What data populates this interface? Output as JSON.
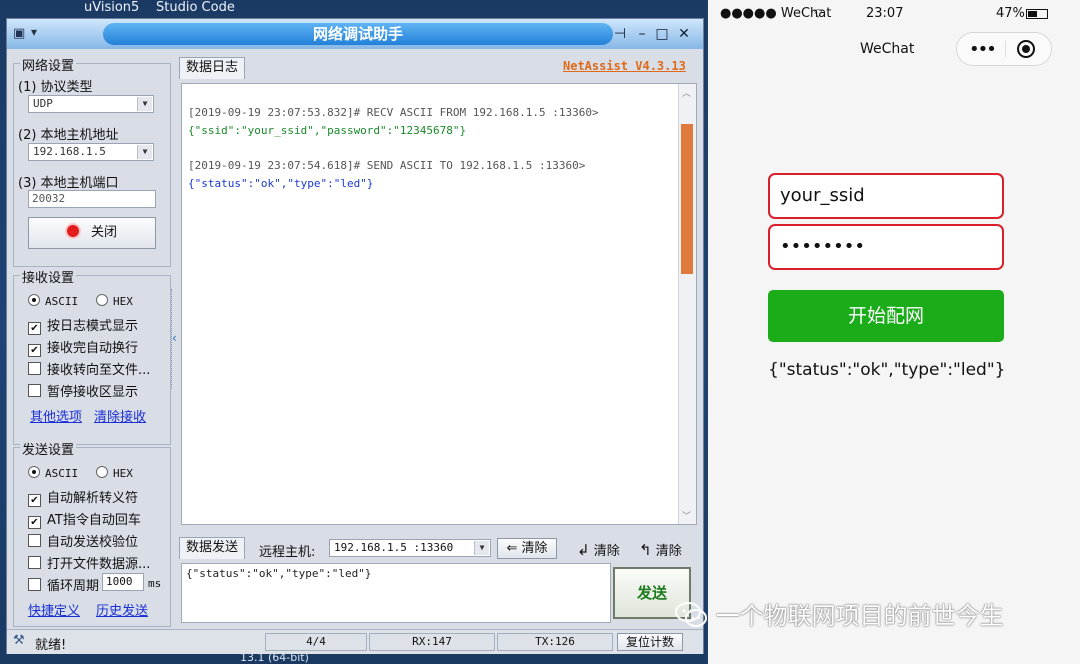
{
  "desktop": {
    "taskbar_top": [
      "uVision5",
      "Studio Code"
    ],
    "taskbar_bottom": "13.1 (64-bit)"
  },
  "netassist": {
    "title": "网络调试助手",
    "version": "NetAssist V4.3.13",
    "net_settings": {
      "title": "网络设置",
      "protocol_label": "(1) 协议类型",
      "protocol_value": "UDP",
      "host_label": "(2) 本地主机地址",
      "host_value": "192.168.1.5",
      "port_label": "(3) 本地主机端口",
      "port_value": "20032",
      "close_button": "关闭"
    },
    "recv_settings": {
      "title": "接收设置",
      "ascii": "ASCII",
      "hex": "HEX",
      "options": [
        {
          "label": "按日志模式显示",
          "checked": true
        },
        {
          "label": "接收完自动换行",
          "checked": true
        },
        {
          "label": "接收转向至文件...",
          "checked": false
        },
        {
          "label": "暂停接收区显示",
          "checked": false
        }
      ],
      "more_link": "其他选项",
      "clear_link": "清除接收"
    },
    "send_settings": {
      "title": "发送设置",
      "ascii": "ASCII",
      "hex": "HEX",
      "options": [
        {
          "label": "自动解析转义符",
          "checked": true
        },
        {
          "label": "AT指令自动回车",
          "checked": true
        },
        {
          "label": "自动发送校验位",
          "checked": false
        },
        {
          "label": "打开文件数据源...",
          "checked": false
        }
      ],
      "loop_label": "循环周期",
      "loop_value": "1000",
      "loop_unit": "ms",
      "shortcut_link": "快捷定义",
      "history_link": "历史发送"
    },
    "log_tab": "数据日志",
    "log": [
      {
        "header": "[2019-09-19 23:07:53.832]# RECV ASCII FROM 192.168.1.5 :13360>",
        "body": "{\"ssid\":\"your_ssid\",\"password\":\"12345678\"}",
        "body_color": "#1a8a2a"
      },
      {
        "header": "[2019-09-19 23:07:54.618]# SEND ASCII TO 192.168.1.5 :13360>",
        "body": "{\"status\":\"ok\",\"type\":\"led\"}",
        "body_color": "#1a3ad0"
      }
    ],
    "send_tab": "数据发送",
    "remote_label": "远程主机:",
    "remote_value": "192.168.1.5 :13360",
    "clear1": "清除",
    "clear2": "清除",
    "clear3": "清除",
    "send_text": "{\"status\":\"ok\",\"type\":\"led\"}",
    "send_button": "发送",
    "status": {
      "ready": "就绪!",
      "count": "4/4",
      "rx": "RX:147",
      "tx": "TX:126",
      "reset": "复位计数"
    }
  },
  "phone": {
    "carrier": "●●●●● WeChat",
    "time": "23:07",
    "battery": "47%",
    "nav_title": "WeChat",
    "ssid_value": "your_ssid",
    "password_value": "••••••••",
    "button": "开始配网",
    "result": "{\"status\":\"ok\",\"type\":\"led\"}"
  },
  "watermark": "一个物联网项目的前世今生"
}
